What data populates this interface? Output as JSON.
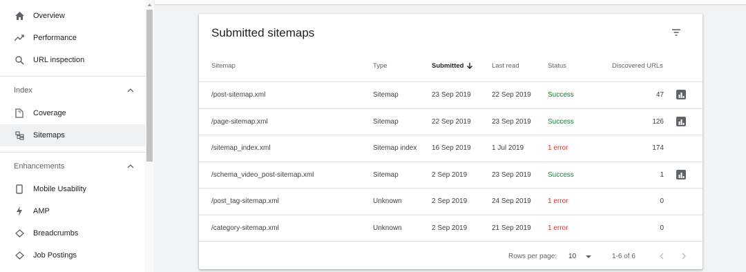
{
  "sidebar": {
    "items": [
      {
        "label": "Overview",
        "icon": "home-icon"
      },
      {
        "label": "Performance",
        "icon": "trending-up-icon"
      },
      {
        "label": "URL inspection",
        "icon": "search-icon"
      }
    ],
    "index_section": {
      "label": "Index",
      "items": [
        {
          "label": "Coverage",
          "icon": "coverage-icon"
        },
        {
          "label": "Sitemaps",
          "icon": "sitemap-icon"
        }
      ]
    },
    "enhancements_section": {
      "label": "Enhancements",
      "items": [
        {
          "label": "Mobile Usability",
          "icon": "phone-icon"
        },
        {
          "label": "AMP",
          "icon": "bolt-icon"
        },
        {
          "label": "Breadcrumbs",
          "icon": "diamond-icon"
        },
        {
          "label": "Job Postings",
          "icon": "diamond-icon"
        }
      ]
    }
  },
  "card": {
    "title": "Submitted sitemaps",
    "columns": [
      "Sitemap",
      "Type",
      "Submitted",
      "Last read",
      "Status",
      "Discovered URLs"
    ],
    "rows": [
      {
        "sitemap": "/post-sitemap.xml",
        "type": "Sitemap",
        "submitted": "23 Sep 2019",
        "last_read": "22 Sep 2019",
        "status": "Success",
        "urls": "47",
        "has_chart": true
      },
      {
        "sitemap": "/page-sitemap.xml",
        "type": "Sitemap",
        "submitted": "22 Sep 2019",
        "last_read": "23 Sep 2019",
        "status": "Success",
        "urls": "126",
        "has_chart": true
      },
      {
        "sitemap": "/sitemap_index.xml",
        "type": "Sitemap index",
        "submitted": "16 Sep 2019",
        "last_read": "1 Jul 2019",
        "status": "1 error",
        "urls": "174",
        "has_chart": false
      },
      {
        "sitemap": "/schema_video_post-sitemap.xml",
        "type": "Sitemap",
        "submitted": "2 Sep 2019",
        "last_read": "23 Sep 2019",
        "status": "Success",
        "urls": "1",
        "has_chart": true
      },
      {
        "sitemap": "/post_tag-sitemap.xml",
        "type": "Unknown",
        "submitted": "2 Sep 2019",
        "last_read": "24 Sep 2019",
        "status": "1 error",
        "urls": "0",
        "has_chart": false
      },
      {
        "sitemap": "/category-sitemap.xml",
        "type": "Unknown",
        "submitted": "2 Sep 2019",
        "last_read": "21 Sep 2019",
        "status": "1 error",
        "urls": "0",
        "has_chart": false
      }
    ],
    "footer": {
      "rows_per_page_label": "Rows per page:",
      "rows_per_page_value": "10",
      "range": "1-6 of 6"
    }
  },
  "colors": {
    "success": "#188038",
    "error": "#d93025",
    "active_bg": "#eef0f1"
  }
}
